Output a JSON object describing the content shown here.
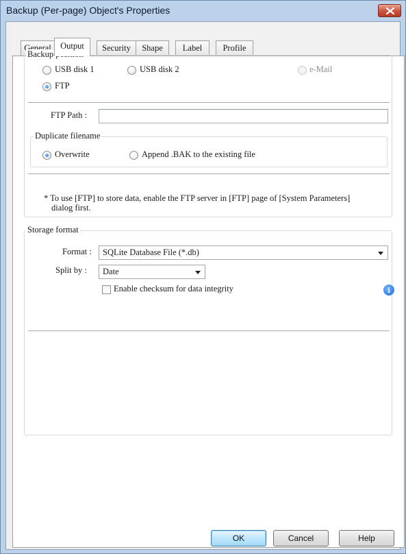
{
  "window": {
    "title": "Backup (Per-page) Object's Properties",
    "close_icon": "close-icon",
    "colors": {
      "titlebar": "#bcd1ea",
      "close_button": "#c8533d",
      "accent_radio": "#1565c0",
      "info_icon": "#1e6fd9"
    }
  },
  "tabs": [
    {
      "label": "General",
      "active": false
    },
    {
      "label": "Output",
      "active": true
    },
    {
      "label": "Security",
      "active": false
    },
    {
      "label": "Shape",
      "active": false
    },
    {
      "label": "Label",
      "active": false
    },
    {
      "label": "Profile",
      "active": false
    }
  ],
  "backup_position": {
    "legend": "Backup position",
    "options": [
      {
        "label": "USB disk 1",
        "checked": false,
        "enabled": true
      },
      {
        "label": "USB disk 2",
        "checked": false,
        "enabled": true
      },
      {
        "label": "e-Mail",
        "checked": false,
        "enabled": false
      },
      {
        "label": "FTP",
        "checked": true,
        "enabled": true
      }
    ],
    "ftp_path_label": "FTP Path :",
    "ftp_path_value": "",
    "duplicate": {
      "legend": "Duplicate filename",
      "options": [
        {
          "label": "Overwrite",
          "checked": true
        },
        {
          "label": "Append .BAK to the existing file",
          "checked": false
        }
      ]
    },
    "note_line1": "* To use [FTP] to store data, enable the FTP server in [FTP] page of [System Parameters]",
    "note_line2": "dialog first."
  },
  "storage_format": {
    "legend": "Storage format",
    "format_label": "Format :",
    "format_value": "SQLite Database File (*.db)",
    "split_label": "Split by :",
    "split_value": "Date",
    "checksum_label": "Enable checksum for data integrity",
    "checksum_checked": false,
    "info_icon_glyph": "i"
  },
  "buttons": {
    "ok": "OK",
    "cancel": "Cancel",
    "help": "Help"
  }
}
